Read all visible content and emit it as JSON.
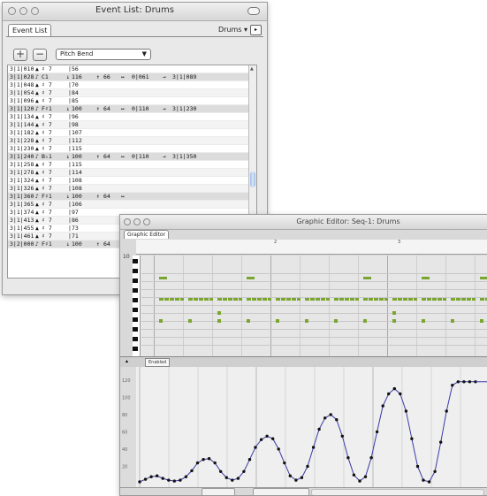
{
  "event_list": {
    "title": "Event List: Drums",
    "tab": "Event List",
    "track_dropdown": "Drums",
    "track_dropdown_arrow": "▾",
    "add_label": "+",
    "remove_label": "−",
    "filter_value": "Pitch Bend",
    "rows": [
      {
        "pos": "3|1|010",
        "kind": "bend",
        "a": "♯ 7",
        "b": "56",
        "d": "",
        "e": ""
      },
      {
        "pos": "3|1|028",
        "kind": "note",
        "a": "C1",
        "b": "116",
        "c": "66",
        "d": "0|061",
        "e": "3|1|089"
      },
      {
        "pos": "3|1|048",
        "kind": "bend",
        "a": "♯ 7",
        "b": "70",
        "d": "",
        "e": ""
      },
      {
        "pos": "3|1|054",
        "kind": "bend",
        "a": "♯ 7",
        "b": "84",
        "d": "",
        "e": ""
      },
      {
        "pos": "3|1|096",
        "kind": "bend",
        "a": "♯ 7",
        "b": "85",
        "d": "",
        "e": ""
      },
      {
        "pos": "3|1|120",
        "kind": "note",
        "a": "F♯1",
        "b": "100",
        "c": "64",
        "d": "0|110",
        "e": "3|1|230"
      },
      {
        "pos": "3|1|134",
        "kind": "bend",
        "a": "♯ 7",
        "b": "96",
        "d": "",
        "e": ""
      },
      {
        "pos": "3|1|144",
        "kind": "bend",
        "a": "♯ 7",
        "b": "98",
        "d": "",
        "e": ""
      },
      {
        "pos": "3|1|182",
        "kind": "bend",
        "a": "♯ 7",
        "b": "107",
        "d": "",
        "e": ""
      },
      {
        "pos": "3|1|228",
        "kind": "bend",
        "a": "♯ 7",
        "b": "112",
        "d": "",
        "e": ""
      },
      {
        "pos": "3|1|230",
        "kind": "bend",
        "a": "♯ 7",
        "b": "115",
        "d": "",
        "e": ""
      },
      {
        "pos": "3|1|240",
        "kind": "note",
        "a": "B♭1",
        "b": "100",
        "c": "64",
        "d": "0|110",
        "e": "3|1|350"
      },
      {
        "pos": "3|1|258",
        "kind": "bend",
        "a": "♯ 7",
        "b": "115",
        "d": "",
        "e": ""
      },
      {
        "pos": "3|1|278",
        "kind": "bend",
        "a": "♯ 7",
        "b": "114",
        "d": "",
        "e": ""
      },
      {
        "pos": "3|1|324",
        "kind": "bend",
        "a": "♯ 7",
        "b": "108",
        "d": "",
        "e": ""
      },
      {
        "pos": "3|1|326",
        "kind": "bend",
        "a": "♯ 7",
        "b": "108",
        "d": "",
        "e": ""
      },
      {
        "pos": "3|1|360",
        "kind": "note",
        "a": "F♯1",
        "b": "100",
        "c": "64",
        "d": "",
        "e": ""
      },
      {
        "pos": "3|1|365",
        "kind": "bend",
        "a": "♯ 7",
        "b": "106",
        "d": "",
        "e": ""
      },
      {
        "pos": "3|1|374",
        "kind": "bend",
        "a": "♯ 7",
        "b": "97",
        "d": "",
        "e": ""
      },
      {
        "pos": "3|1|413",
        "kind": "bend",
        "a": "♯ 7",
        "b": "86",
        "d": "",
        "e": ""
      },
      {
        "pos": "3|1|455",
        "kind": "bend",
        "a": "♯ 7",
        "b": "73",
        "d": "",
        "e": ""
      },
      {
        "pos": "3|1|461",
        "kind": "bend",
        "a": "♯ 7",
        "b": "71",
        "d": "",
        "e": ""
      },
      {
        "pos": "3|2|000",
        "kind": "note",
        "a": "F♯1",
        "b": "100",
        "c": "64",
        "d": "",
        "e": ""
      }
    ]
  },
  "graphic_editor": {
    "title": "Graphic Editor: Seq-1: Drums",
    "tab": "Graphic Editor",
    "ruler_mark_1": "2",
    "ruler_mark_2": "3",
    "ruler_left_label": "10",
    "controller_label": "Enabled",
    "y_ticks": [
      "120",
      "100",
      "80",
      "60",
      "40",
      "20"
    ],
    "curve_points": [
      2,
      5,
      8,
      9,
      6,
      4,
      3,
      4,
      8,
      15,
      24,
      28,
      29,
      24,
      14,
      7,
      4,
      6,
      14,
      28,
      42,
      51,
      55,
      52,
      40,
      24,
      9,
      4,
      7,
      20,
      42,
      63,
      76,
      80,
      74,
      55,
      30,
      10,
      3,
      8,
      30,
      60,
      90,
      104,
      110,
      104,
      84,
      52,
      20,
      4,
      2,
      14,
      48,
      84,
      114,
      118,
      118,
      118,
      118
    ],
    "note_rows": [
      {
        "row": 0,
        "cols": []
      },
      {
        "row": 1,
        "cols": [
          0,
          3,
          7,
          9,
          11
        ]
      },
      {
        "row": 2,
        "cols": []
      },
      {
        "row": 3,
        "cols": [
          0,
          1,
          2,
          3,
          4,
          5,
          6,
          7,
          8,
          9,
          10,
          11
        ]
      },
      {
        "row": 4,
        "cols": [
          2,
          8
        ]
      },
      {
        "row": 5,
        "cols": [
          0,
          1,
          2,
          3,
          4,
          5,
          6,
          7,
          8,
          9,
          10,
          11
        ]
      }
    ]
  }
}
